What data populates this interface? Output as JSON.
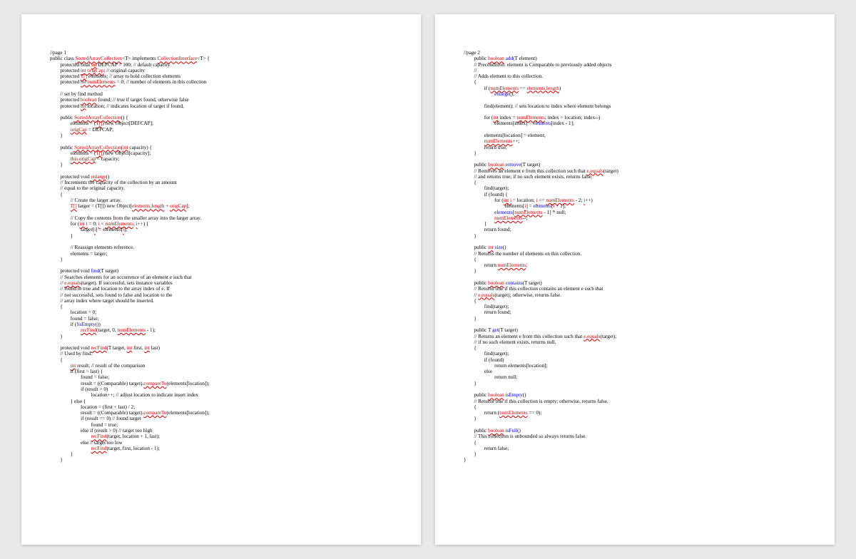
{
  "pages": {
    "page1": {
      "label": "//page 1",
      "code": "public class <e>SortedArrayCollection</e><T> implements <e>CollectionInterface</e><T> {\n        protected final <e>int</e> DEFCAP = 100; // default capacity\n        protected <e>int origCap</e>; // original capacity\n        protected <e>T[]</e> elements; // array to hold collection elements\n        protected <e>int numElements</e> = 0; // number of elements in this collection\n\n        // set by find method\n        protected <e>boolean</e> found; // true if target found, otherwise false\n        protected <e>int</e> location; // indicates location of target if found,\n\n        public <e>SortedArrayCollection</e>() {\n                elements = (<e>T[]</e>) new Object[DEFCAP];\n                <e>origCap</e> = DEFCAP;\n        }\n\n        public <e>SortedArrayCollection</e>(<e>int</e> capacity) {\n                elements = (<e>T[]</e>) new Object[capacity];\n                <e>this.origCap</e> = capacity;\n        }\n\n        protected void <e>enlarge</e>()\n        // Increments the capacity of the collection by an amount\n        // equal to the original capacity.\n        {\n                // Create the larger array.\n                <e>T[]</e> larger = (T[]) new Object[<e>elements.length</e> + <e>origCap</e>];\n\n                // Copy the contents from the smaller array into the larger array.\n                for (<e>int i</e> = 0; <e>i</e> < <e>numElements</e>; <e>i</e>++) {\n                        larger[<e>i</e>] = elements[<e>i</e>];\n                }\n\n                // Reassign elements reference.\n                elements = larger;\n        }\n\n        protected void <b>find</b>(T target)\n        // Searches elements for an occurrence of an element e such that\n        // <e>e.equals</e>(target). If successful, sets instance variables\n        // found to true and location to the array index of e. If\n        // not successful, sets found to false and location to the\n        // array index where target should be inserted.\n        {\n                location = 0;\n                found = false;\n                if (!<b>isEmpty</b>())\n                        <e>recFind</e>(target, 0, <e>numElements</e> - 1);\n        }\n\n        protected void <e>recFind</e>(T target, <e>int</e> first, <e>int</e> last)\n        // Used by find.\n        {\n                <e>int</e> result; // result of the comparison\n                if (first > last) {\n                        found = false;\n                        result = ((Comparable) target).<e>compareTo</e>(elements[location]);\n                        if (result > 0)\n                                location++; // adjust location to indicate insert index\n                } else {\n                        location = (first + last) / 2;\n                        result = ((Comparable) target).<e>compareTo</e>(elements[location]);\n                        if (result == 0) // found target\n                                found = true;\n                        else if (result > 0) // target too high\n                                <e>recFind</e>(target, location + 1, last);\n                        else // target too low\n                                <e>recFind</e>(target, first, location - 1);\n                }\n        }"
    },
    "page2": {
      "label": "//page 2",
      "code": "        public <e>boolean</e> <b>add</b>(T element)\n        // Precondition: element is Comparable to previously added objects\n        //\n        // Adds element to this collection.\n        {\n                if (<e>numElements</e> == <e>elements.length</e>)\n                        <b>enlarge</b>();\n\n                find(element); // sets location to index where element belongs\n\n                for (<e>int</e> index = <e>numElements</e>; index > location; index--)\n                        elements[index] = <b>elements</b>[index - 1];\n\n                elements[location] = element;\n                <e>numElements</e>++;\n                return true;\n        }\n\n        public <e>boolean</e> <b>remove</b>(T target)\n        // Removes an element e from this collection such that <e>e.equals</e>(target)\n        // and returns true; if no such element exists, returns false.\n        {\n                find(target);\n                if (found) {\n                        for (<e>int i</e> = location; <e>i</e> <= <e>numElements</e> - 2; <e>i</e>++)\n                                elements[<e>i</e>] = <b>elements</b>[<e>i</e> + 1];\n                        <b>elements</b>[<e>numElements</e> - 1] = null;\n                        <e>numElements</e>--;\n                }\n                return found;\n        }\n\n        public <e>int</e> <b>size</b>()\n        // Returns the number of elements on this collection.\n        {\n                return <e>numElements</e>;\n        }\n\n        public <e>boolean</e> <b>contains</b>(T target)\n        // Returns true if this collection contains an element e such that\n        // <e>e.equals</e>(target); otherwise, returns false.\n        {\n                find(target);\n                return found;\n        }\n\n        public T <b>get</b>(T target)\n        // Returns an element e from this collection such that <e>e.equals</e>(target);\n        // if no such element exists, returns null.\n        {\n                find(target);\n                if (found)\n                        return elements[location];\n                else\n                        return null;\n        }\n\n        public <e>boolean</e> <b>isEmpty</b>()\n        // Returns true if this collection is empty; otherwise, returns false.\n        {\n                return (<e>numElements</e> == 0);\n        }\n\n        public <e>boolean</e> <b>isFull</b>()\n        // This collection is unbounded so always returns false.\n        {\n                return false;\n        }\n}"
    }
  }
}
